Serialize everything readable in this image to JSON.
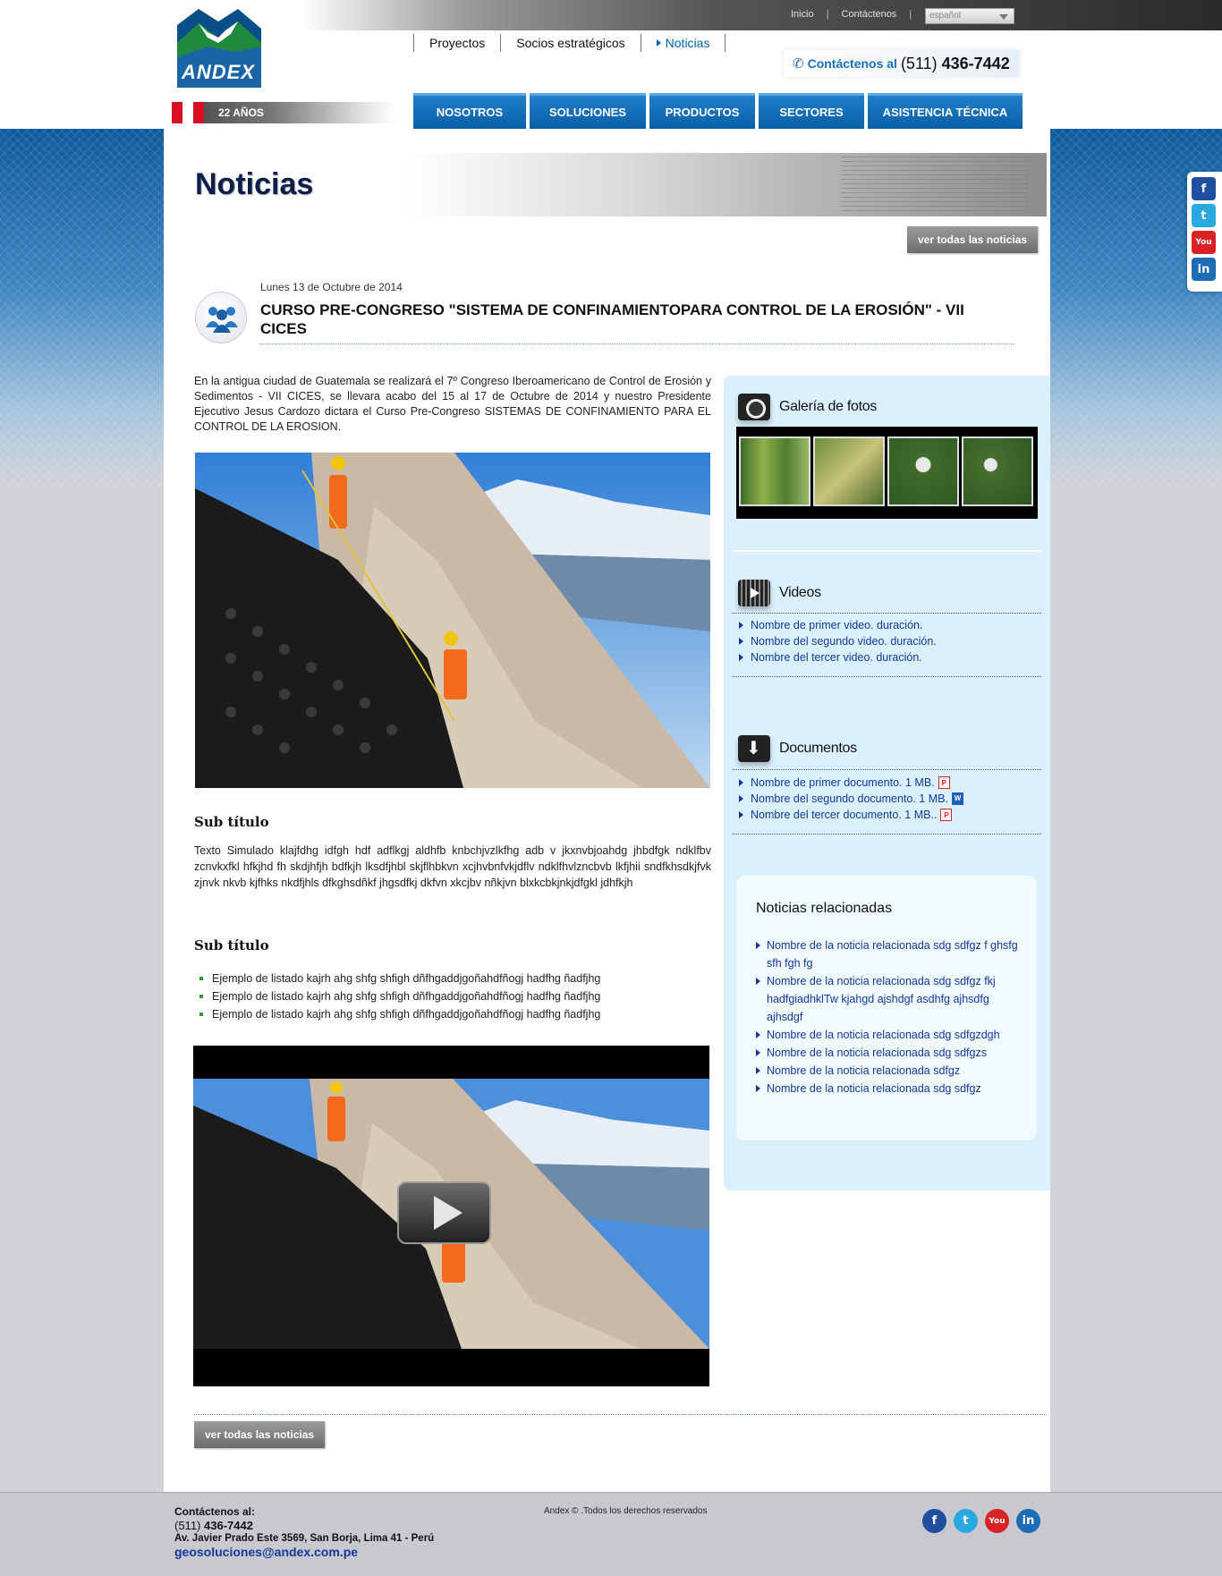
{
  "util": {
    "inicio": "Inicio",
    "contactenos": "Contáctenos",
    "language": "español"
  },
  "logo": {
    "text": "ANDEX",
    "years": "22 AÑOS"
  },
  "subnav": [
    {
      "label": "Proyectos",
      "active": false
    },
    {
      "label": "Socios estratégicos",
      "active": false
    },
    {
      "label": "Noticias",
      "active": true
    }
  ],
  "phone": {
    "label": "Contáctenos al",
    "prefix": "(511)",
    "number": "436-7442"
  },
  "mainnav": [
    "NOSOTROS",
    "SOLUCIONES",
    "PRODUCTOS",
    "SECTORES",
    "ASISTENCIA TÉCNICA"
  ],
  "banner": {
    "title": "Noticias"
  },
  "buttons": {
    "ver_todas": "ver todas las noticias"
  },
  "news": {
    "date": "Lunes 13 de Octubre de 2014",
    "title": "CURSO PRE-CONGRESO \"SISTEMA DE CONFINAMIENTOPARA CONTROL DE LA EROSIÓN\" - VII CICES",
    "lead": "En la antigua ciudad de Guatemala se realizará el 7º Congreso Iberoamericano de Control de Erosión y Sedimentos - VII CICES, se llevara acabo del 15 al 17 de Octubre de 2014 y nuestro Presidente Ejecutivo Jesus Cardozo dictara el Curso Pre-Congreso SISTEMAS DE CONFINAMIENTO PARA EL CONTROL DE LA EROSION.",
    "subtitle1": "Sub título",
    "body": "Texto Simulado klajfdhg idfgh hdf adflkgj aldhfb knbchjvzlkfhg adb v jkxnvbjoahdg jhbdfgk ndklfbv zcnvkxfkl hfkjhd fh skdjhfjh bdfkjh lksdfjhbl skjflhbkvn xcjhvbnfvkjdflv ndklfhvlzncbvb lkfjhii sndfkhsdkjfvk zjnvk nkvb kjfhks nkdfjhls dfkghsdñkf jhgsdfkj dkfvn xkcjbv nñkjvn blxkcbkjnkjdfgkl jdhfkjh",
    "subtitle2": "Sub título",
    "list": [
      "Ejemplo de listado  kajrh ahg shfg shfigh dñfhgaddjgoñahdfñogj hadfhg ñadfjhg",
      "Ejemplo de listado  kajrh ahg shfg shfigh dñfhgaddjgoñahdfñogj hadfhg ñadfjhg",
      "Ejemplo de listado  kajrh ahg shfg shfigh dñfhgaddjgoñahdfñogj hadfhg ñadfjhg"
    ]
  },
  "sidebar": {
    "gallery_title": "Galería de fotos",
    "videos_title": "Videos",
    "videos": [
      "Nombre de primer video. duración.",
      "Nombre del segundo video. duración.",
      "Nombre del tercer video. duración."
    ],
    "docs_title": "Documentos",
    "docs": [
      {
        "label": "Nombre de primer documento. 1 MB.",
        "type": "pdf"
      },
      {
        "label": "Nombre del segundo documento. 1 MB.",
        "type": "word"
      },
      {
        "label": "Nombre del tercer documento. 1 MB..",
        "type": "pdf"
      }
    ],
    "related_title": "Noticias relacionadas",
    "related": [
      "Nombre de la noticia relacionada sdg sdfgz f ghsfg sfh fgh fg",
      "Nombre de la noticia relacionada sdg sdfgz fkj hadfgiadhklTw kjahgd ajshdgf asdhfg ajhsdfg ajhsdgf",
      "Nombre de la noticia relacionada sdg sdfgzdgh",
      "Nombre de la noticia relacionada sdg sdfgzs",
      "Nombre de la noticia relacionada sdfgz",
      "Nombre de la noticia relacionada sdg sdfgz"
    ]
  },
  "footer": {
    "contact_label": "Contáctenos al:",
    "phone_prefix": "(511)",
    "phone": "436-7442",
    "address": "Av. Javier Prado Este 3569, San Borja, Lima 41 - Perú",
    "email": "geosoluciones@andex.com.pe",
    "copyright": "Andex © .Todos los derechos reservados"
  },
  "colors": {
    "nav_blue": "#0b5fa8",
    "link_blue": "#14389a",
    "sidebar_bg": "#daf0fc"
  },
  "icons": [
    "facebook-icon",
    "twitter-icon",
    "youtube-icon",
    "linkedin-icon",
    "phone-icon",
    "camera-icon",
    "film-icon",
    "download-icon",
    "pdf-icon",
    "word-icon",
    "people-icon",
    "play-icon"
  ]
}
